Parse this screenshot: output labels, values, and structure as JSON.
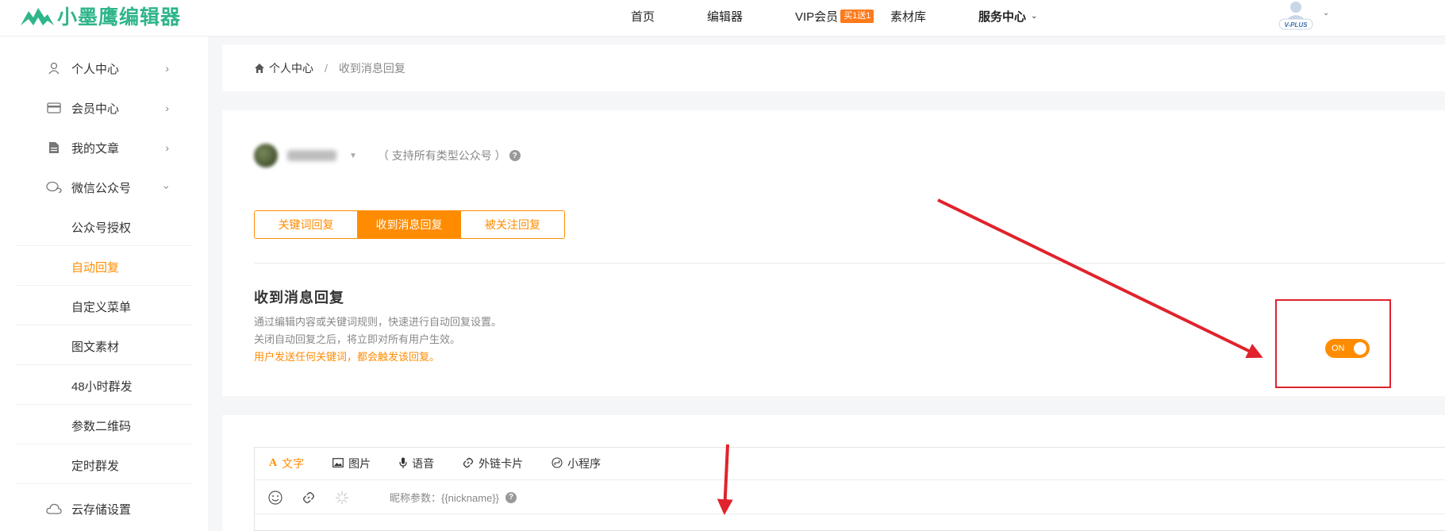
{
  "header": {
    "logo_text": "小墨鹰编辑器",
    "nav": {
      "home": "首页",
      "editor": "编辑器",
      "vip": "VIP会员",
      "vip_badge": "买1送1",
      "material": "素材库",
      "service": "服务中心"
    },
    "avatar_badge": "V-PLUS"
  },
  "sidebar": {
    "items": [
      {
        "label": "个人中心",
        "icon": "user-icon"
      },
      {
        "label": "会员中心",
        "icon": "card-icon"
      },
      {
        "label": "我的文章",
        "icon": "document-icon"
      },
      {
        "label": "微信公众号",
        "icon": "chat-icon"
      }
    ],
    "sub_items": [
      "公众号授权",
      "自动回复",
      "自定义菜单",
      "图文素材",
      "48小时群发",
      "参数二维码",
      "定时群发"
    ],
    "active_sub": "自动回复",
    "storage": {
      "label": "云存储设置",
      "icon": "cloud-icon"
    }
  },
  "breadcrumb": {
    "root": "个人中心",
    "separator": "/",
    "current": "收到消息回复"
  },
  "account": {
    "note": "（ 支持所有类型公众号 ）"
  },
  "tabs": [
    "关键词回复",
    "收到消息回复",
    "被关注回复"
  ],
  "active_tab": 1,
  "section": {
    "title": "收到消息回复",
    "desc1": "通过编辑内容或关键词规则，快速进行自动回复设置。",
    "desc2": "关闭自动回复之后，将立即对所有用户生效。",
    "desc3": "用户发送任何关键词，都会触发该回复。"
  },
  "toggle": {
    "label": "ON",
    "state": true
  },
  "editor": {
    "tabs": [
      {
        "label": "文字",
        "icon": "text-icon"
      },
      {
        "label": "图片",
        "icon": "image-icon"
      },
      {
        "label": "语音",
        "icon": "mic-icon"
      },
      {
        "label": "外链卡片",
        "icon": "link-icon"
      },
      {
        "label": "小程序",
        "icon": "miniprogram-icon"
      }
    ],
    "nickname_label": "昵称参数：{{nickname}}"
  },
  "colors": {
    "brand": "#2fb58a",
    "accent": "#ff8c00",
    "annotation": "#e0232c"
  }
}
